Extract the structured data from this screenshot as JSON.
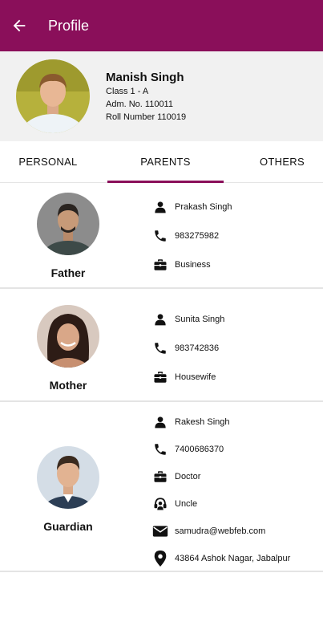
{
  "appbar": {
    "title": "Profile",
    "color": "#8a0f5a"
  },
  "student": {
    "name": "Manish Singh",
    "class_line": "Class 1 - A",
    "adm_line": "Adm. No.  110011",
    "roll_line": "Roll Number  110019"
  },
  "tabs": [
    {
      "label": "PERSONAL",
      "active": false
    },
    {
      "label": "PARENTS",
      "active": true
    },
    {
      "label": "OTHERS",
      "active": false
    }
  ],
  "father": {
    "role": "Father",
    "name": "Prakash Singh",
    "phone": "983275982",
    "occupation": "Business"
  },
  "mother": {
    "role": "Mother",
    "name": "Sunita Singh",
    "phone": "983742836",
    "occupation": "Housewife"
  },
  "guardian": {
    "role": "Guardian",
    "name": "Rakesh Singh",
    "phone": "7400686370",
    "occupation": "Doctor",
    "relation": "Uncle",
    "email": "samudra@webfeb.com",
    "address": "43864 Ashok Nagar, Jabalpur"
  }
}
